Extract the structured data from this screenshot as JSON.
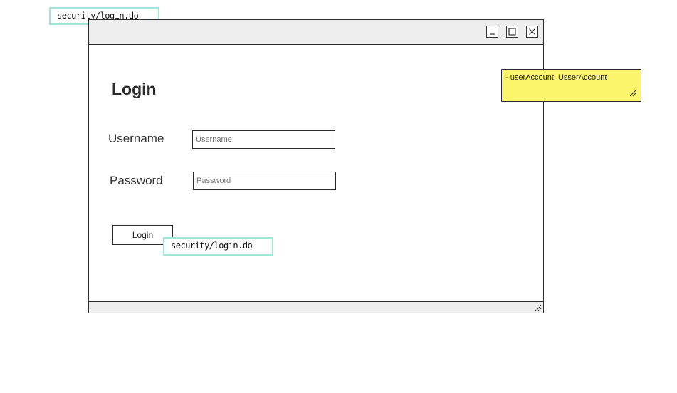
{
  "link_tags": {
    "top": "security/login.do",
    "button": "security/login.do"
  },
  "window": {
    "controls": {
      "minimize": "minimize-icon",
      "maximize": "maximize-icon",
      "close": "close-icon"
    }
  },
  "form": {
    "title": "Login",
    "username_label": "Username",
    "username_placeholder": "Username",
    "password_label": "Password",
    "password_placeholder": "Password",
    "login_button": "Login"
  },
  "note": {
    "text": "- userAccount: UsserAccount"
  }
}
